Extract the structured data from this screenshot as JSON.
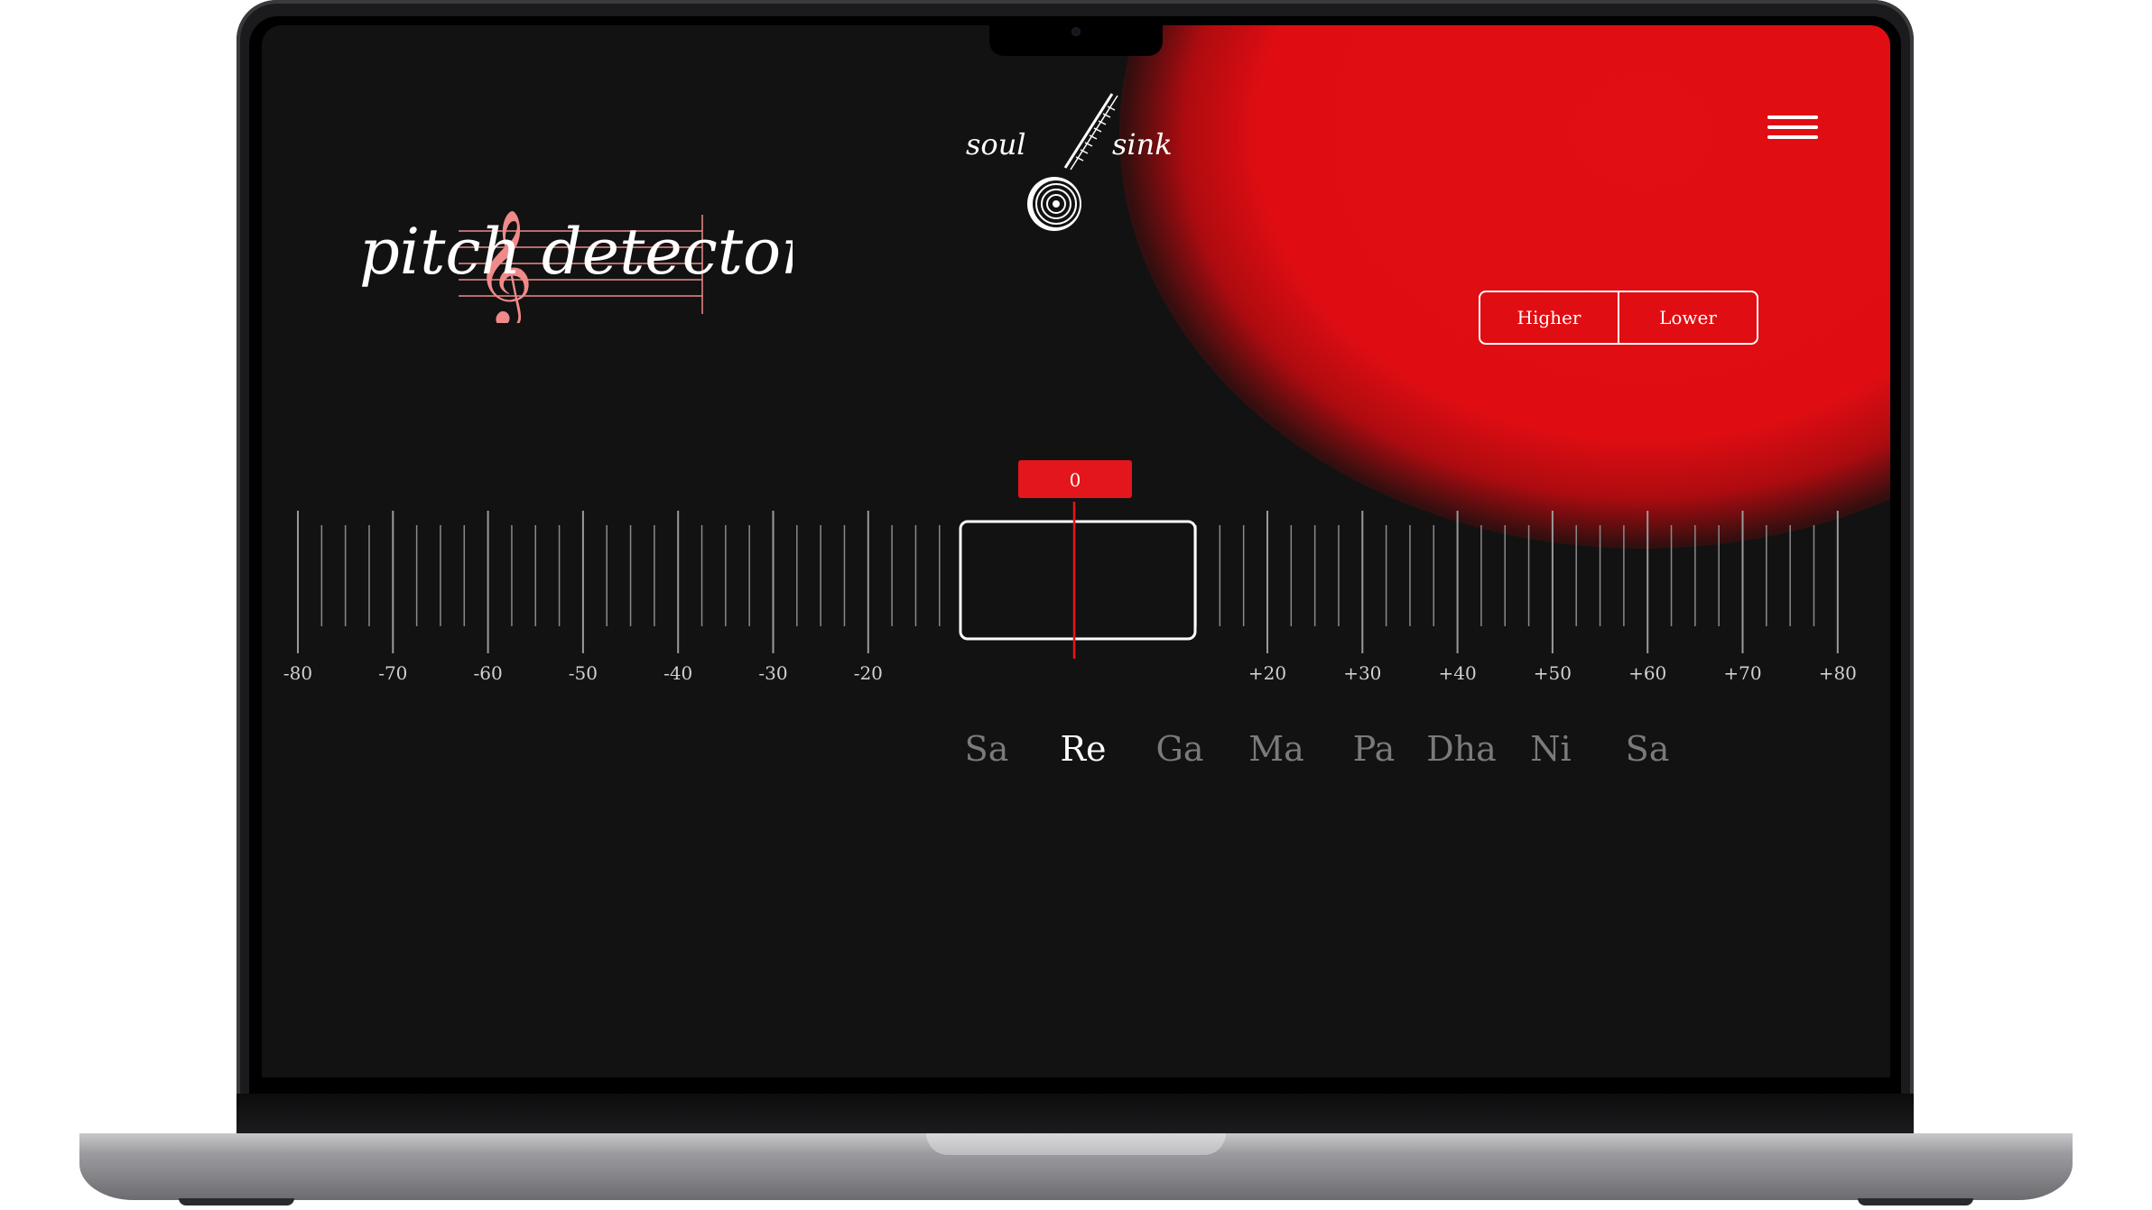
{
  "app": {
    "logo_left": "soul",
    "logo_right": "sink",
    "title": "pitch detector"
  },
  "octave_toggle": {
    "higher": "Higher",
    "lower": "Lower"
  },
  "tuner": {
    "deviation_label": "0",
    "deviation_cents": 0,
    "left_scale": [
      "-80",
      "-70",
      "-60",
      "-50",
      "-40",
      "-30",
      "-20"
    ],
    "right_scale": [
      "+20",
      "+30",
      "+40",
      "+50",
      "+60",
      "+70",
      "+80"
    ]
  },
  "swaras": {
    "items": [
      "Sa",
      "Re",
      "Ga",
      "Ma",
      "Pa",
      "Dha",
      "Ni",
      "Sa"
    ],
    "active_index": 1
  },
  "colors": {
    "background": "#121212",
    "accent": "#e3161b",
    "foreground": "#ffffff",
    "inactive_note": "#7a7a7a",
    "title_staff": "#f08a8a"
  },
  "icons": {
    "menu": "hamburger-menu-icon",
    "logo": "sitar-record-logo-icon",
    "clef": "treble-clef-icon"
  }
}
